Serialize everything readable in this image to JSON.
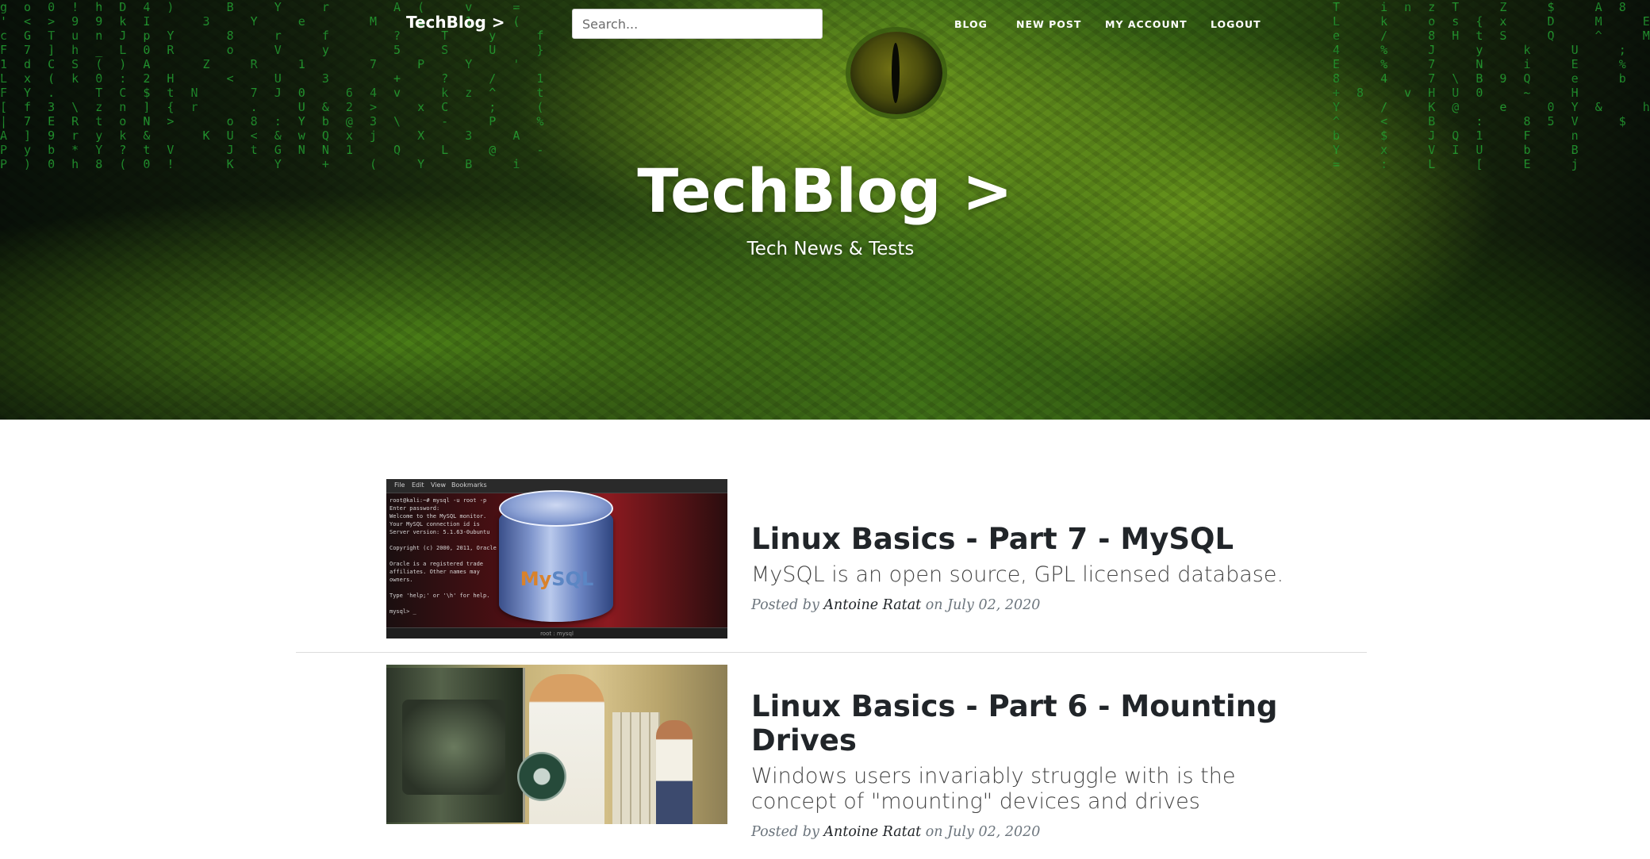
{
  "brand": {
    "name": "TechBlog >"
  },
  "search": {
    "placeholder": "Search..."
  },
  "nav": {
    "items": [
      "BLOG",
      "NEW POST",
      "MY ACCOUNT",
      "LOGOUT"
    ]
  },
  "hero": {
    "title": "TechBlog >",
    "subtitle": "Tech News & Tests"
  },
  "posts": [
    {
      "title": "Linux Basics - Part 7 - MySQL",
      "subtitle": "MySQL is an open source, GPL licensed database.",
      "meta_prefix": "Posted by",
      "author": "Antoine Ratat",
      "date_text": "on July 02, 2020"
    },
    {
      "title": "Linux Basics - Part 6 - Mounting Drives",
      "subtitle": "Windows users invariably struggle with is the concept of \"mounting\" devices and drives",
      "meta_prefix": "Posted by",
      "author": "Antoine Ratat",
      "date_text": "on July 02, 2020"
    }
  ],
  "colors": {
    "text_dark": "#212529",
    "meta_gray": "#6c757d",
    "matrix_green": "#2ecc40"
  }
}
